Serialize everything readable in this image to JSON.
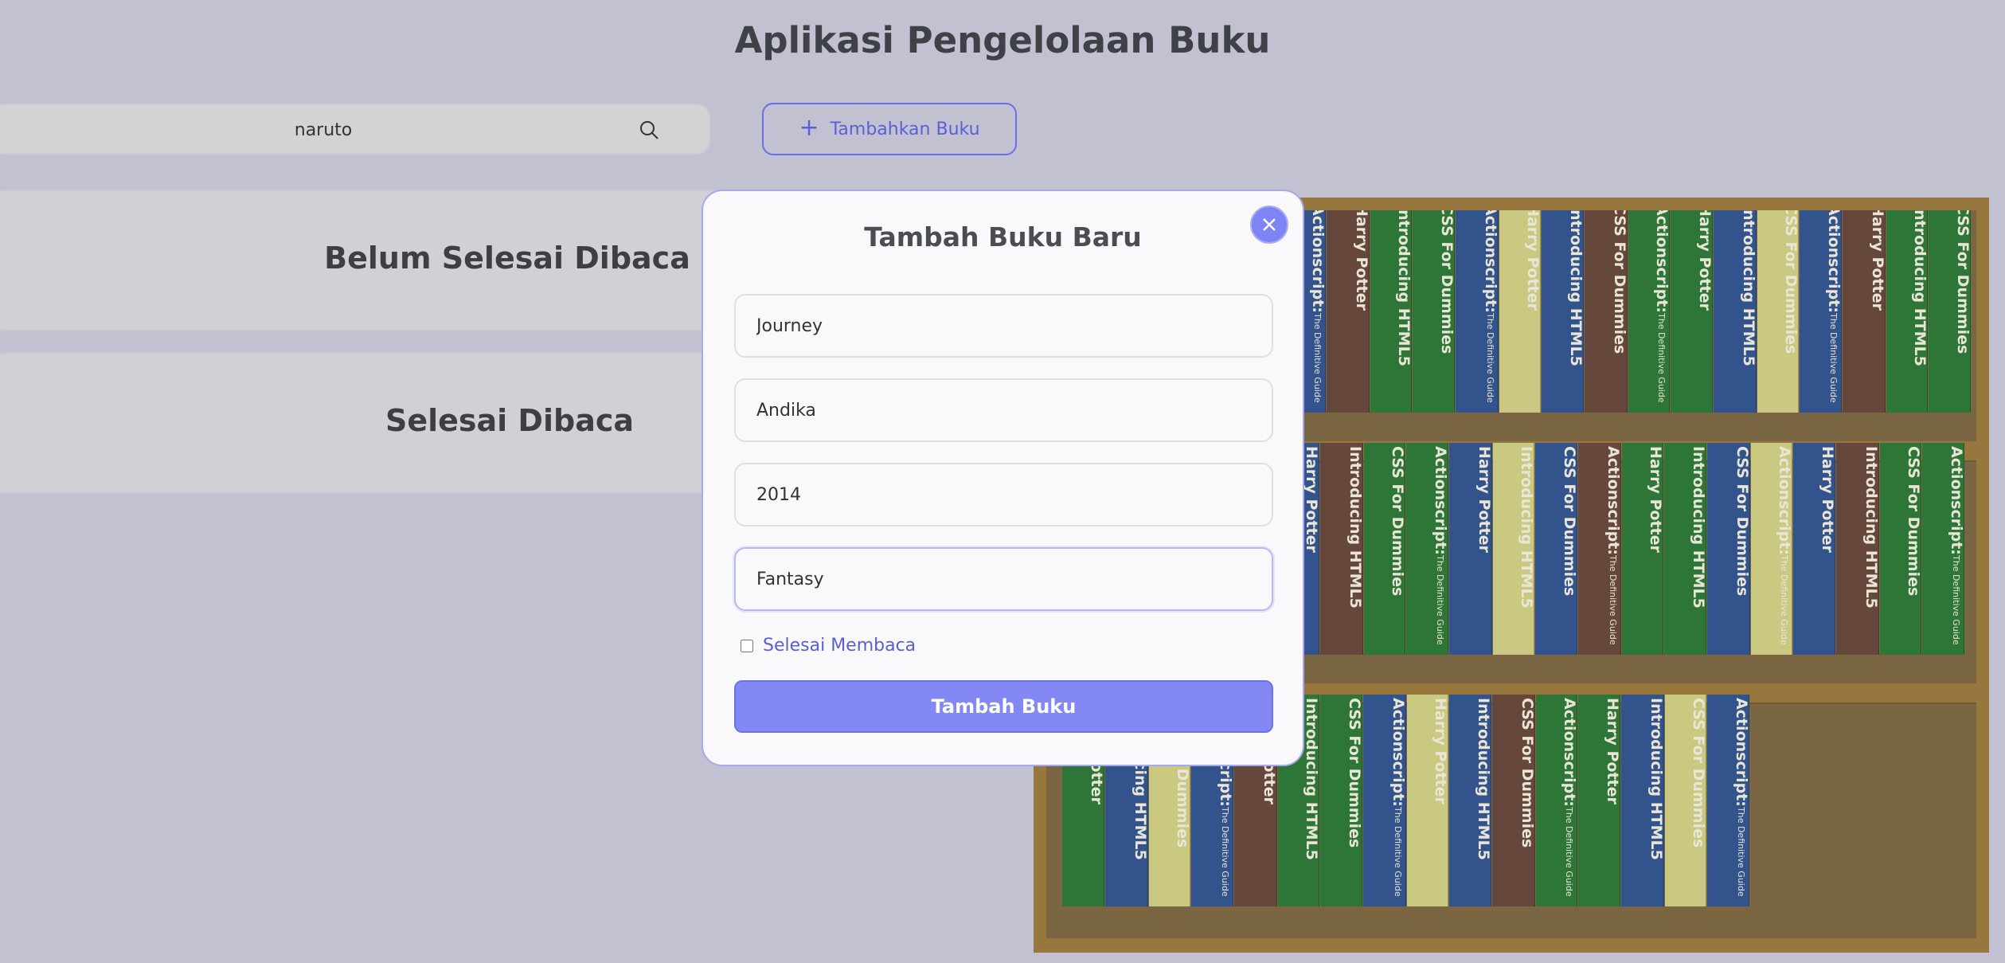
{
  "header": {
    "title": "Aplikasi Pengelolaan Buku"
  },
  "search": {
    "value": "naruto",
    "icon": "search-icon"
  },
  "toolbar": {
    "add_label": "Tambahkan Buku",
    "add_icon": "plus-icon"
  },
  "sections": {
    "unread_title": "Belum Selesai Dibaca",
    "read_title": "Selesai Dibaca"
  },
  "modal": {
    "title": "Tambah Buku Baru",
    "close_icon": "close-icon",
    "fields": {
      "title_value": "Journey",
      "author_value": "Andika",
      "year_value": "2014",
      "genre_value": "Fantasy"
    },
    "checkbox_label": "Selesai Membaca",
    "checkbox_checked": false,
    "submit_label": "Tambah Buku"
  },
  "shelf": {
    "books": [
      "CSS For Dummies",
      "Actionscript:",
      "The Definitive Guide",
      "Harry Potter",
      "Introducing HTML5"
    ]
  },
  "colors": {
    "accent": "#7f84f4",
    "background": "#c2c1d1",
    "shelf_wood": "#97773e"
  }
}
